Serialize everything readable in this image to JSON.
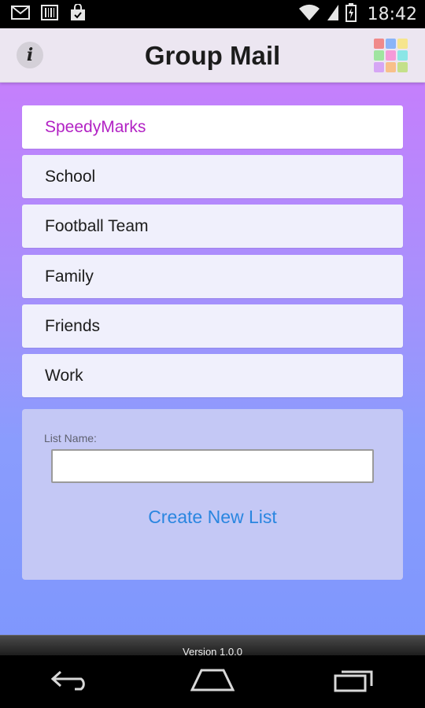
{
  "status_bar": {
    "time": "18:42",
    "icons": [
      "gmail-icon",
      "barcode-icon",
      "shopping-bag-icon",
      "wifi-icon",
      "signal-icon",
      "battery-charging-icon"
    ]
  },
  "app_bar": {
    "title": "Group Mail",
    "info_glyph": "i",
    "grid_colors": [
      "#f08a8a",
      "#8ab4f8",
      "#f6e58d",
      "#a0e4a0",
      "#f59ad8",
      "#8ae6e6",
      "#d6a6f5",
      "#f8c08a",
      "#c4e08a"
    ]
  },
  "lists": [
    {
      "label": "SpeedyMarks",
      "selected": true
    },
    {
      "label": "School",
      "selected": false
    },
    {
      "label": "Football Team",
      "selected": false
    },
    {
      "label": "Family",
      "selected": false
    },
    {
      "label": "Friends",
      "selected": false
    },
    {
      "label": "Work",
      "selected": false
    }
  ],
  "create_panel": {
    "label": "List Name:",
    "input_value": "",
    "button_label": "Create New List"
  },
  "footer": {
    "version": "Version 1.0.0"
  },
  "nav_bar": {
    "icons": [
      "back-icon",
      "home-icon",
      "recent-apps-icon"
    ]
  },
  "colors": {
    "accent": "#b222c4",
    "link": "#2a86e0",
    "gradient_top": "#c57ffc",
    "gradient_bottom": "#7f97fd"
  }
}
